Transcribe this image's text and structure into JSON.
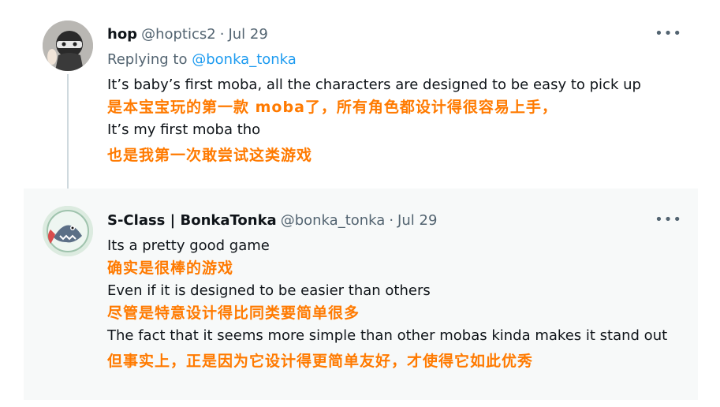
{
  "tweets": [
    {
      "name": "hop",
      "handle": "@hoptics2",
      "date": "Jul 29",
      "replying_to_prefix": "Replying to",
      "replying_to_handle": "@bonka_tonka",
      "lines": [
        {
          "lang": "en",
          "text": "It’s baby’s first moba, all the characters are designed to be easy to pick up"
        },
        {
          "lang": "zh",
          "text": "是本宝宝玩的第一款 moba了，所有角色都设计得很容易上手，"
        },
        {
          "lang": "en",
          "text": "It’s my first moba tho"
        },
        {
          "lang": "zh",
          "text": "也是我第一次敢尝试这类游戏"
        }
      ],
      "avatar_icon": "masked-character-avatar"
    },
    {
      "name": "S-Class | BonkaTonka",
      "handle": "@bonka_tonka",
      "date": "Jul 29",
      "lines": [
        {
          "lang": "en",
          "text": "Its a pretty good game"
        },
        {
          "lang": "zh",
          "text": "确实是很棒的游戏"
        },
        {
          "lang": "en",
          "text": "Even if it is designed to be easier than others"
        },
        {
          "lang": "zh",
          "text": "尽管是特意设计得比同类要简单很多"
        },
        {
          "lang": "en",
          "text": "The fact that it seems more simple than other mobas kinda makes it stand out"
        },
        {
          "lang": "zh",
          "text": "但事实上，正是因为它设计得更简单友好，才使得它如此优秀"
        }
      ],
      "avatar_icon": "shark-character-avatar"
    }
  ],
  "more_icon_glyph": "•••",
  "separator": "·",
  "colors": {
    "link": "#1d9bf0",
    "translation": "#ff7a00",
    "secondary_text": "#536471",
    "primary_text": "#0f1419"
  }
}
